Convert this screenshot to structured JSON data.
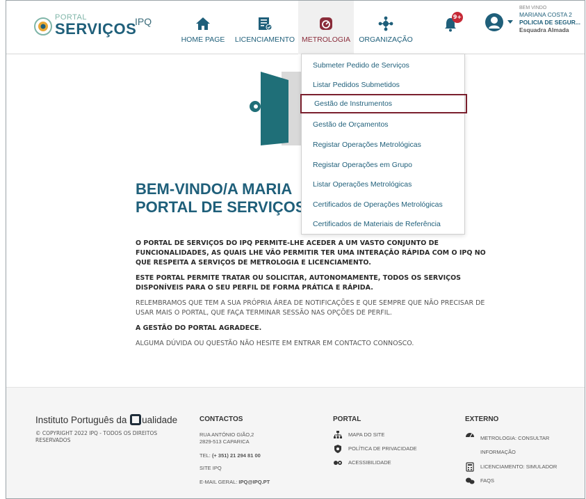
{
  "header": {
    "logo_small": "PORTAL",
    "logo_big": "SERVIÇOS",
    "logo_ipq": "IPQ",
    "nav": {
      "home": "HOME PAGE",
      "licenciamento": "LICENCIAMENTO",
      "metrologia": "METROLOGIA",
      "organizacao": "ORGANIZAÇÃO"
    },
    "notifications_badge": "9+",
    "user": {
      "welcome": "BEM VINDO",
      "name": "MARIANA COSTA 2",
      "org": "POLICIA DE SEGUR...",
      "dept": "Esquadra Almada"
    }
  },
  "dropdown": {
    "items": [
      "Submeter Pedido de Serviços",
      "Listar Pedidos Submetidos",
      "Gestão de Instrumentos",
      "Gestão de Orçamentos",
      "Registar Operações Metrológicas",
      "Registar Operações em Grupo",
      "Listar Operações Metrológicas",
      "Certificados de Operações Metrológicas",
      "Certificados de Materiais de Referência"
    ],
    "highlighted_index": 2
  },
  "main": {
    "welcome_line1": "BEM-VINDO/A MARIA",
    "welcome_line2": "PORTAL DE SERVIÇOS",
    "p1": "O PORTAL DE SERVIÇOS DO IPQ PERMITE-LHE ACEDER A UM VASTO CONJUNTO DE FUNCIONALIDADES, AS QUAIS LHE VÃO PERMITIR TER UMA INTERAÇÃO RÁPIDA COM O IPQ NO QUE RESPEITA A SERVIÇOS DE METROLOGIA E LICENCIAMENTO.",
    "p2": "ESTE PORTAL PERMITE TRATAR OU SOLICITAR, AUTONOMAMENTE, TODOS OS SERVIÇOS DISPONÍVEIS PARA O SEU PERFIL DE FORMA PRÁTICA E RÁPIDA.",
    "p3": "RELEMBRAMOS QUE TEM A SUA PRÓPRIA ÁREA DE NOTIFICAÇÕES E QUE SEMPRE QUE NÃO PRECISAR DE USAR MAIS O PORTAL, QUE FAÇA TERMINAR SESSÃO NAS OPÇÕES DE PERFIL.",
    "p4": "A GESTÃO DO PORTAL AGRADECE.",
    "p5": "ALGUMA DÚVIDA OU QUESTÃO NÃO HESITE EM ENTRAR EM CONTACTO CONNOSCO."
  },
  "footer": {
    "brand_pre": "Instituto Português da",
    "brand_post": "ualidade",
    "copyright": "© COPYRIGHT 2022 IPQ - TODOS OS DIREITOS RESERVADOS",
    "contactos": {
      "heading": "CONTACTOS",
      "address1": "RUA ANTÓNIO GIÃO,2",
      "address2": "2829-513 CAPARICA",
      "tel_label": "TEL: ",
      "tel": "(+ 351) 21 294 81 00",
      "site": "SITE IPQ",
      "email_label": "E-MAIL GERAL: ",
      "email": "IPQ@IPQ.PT"
    },
    "portal": {
      "heading": "PORTAL",
      "links": [
        "MAPA DO SITE",
        "POLÍTICA DE PRIVACIDADE",
        "ACESSIBILIDADE"
      ]
    },
    "externo": {
      "heading": "EXTERNO",
      "links": [
        "METROLOGIA: CONSULTAR INFORMAÇÃO",
        "LICENCIAMENTO: SIMULADOR",
        "FAQS"
      ]
    }
  },
  "colors": {
    "brand_teal": "#1f5f7a",
    "highlight_border": "#7a1f2d",
    "badge_red": "#c62936"
  }
}
